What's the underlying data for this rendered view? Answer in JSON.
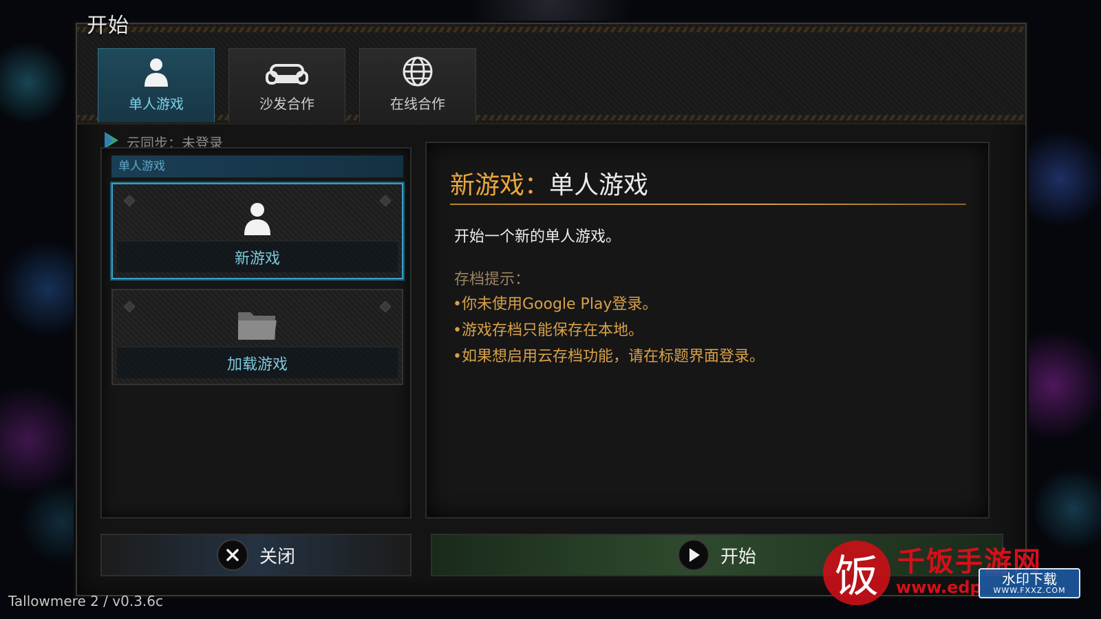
{
  "window": {
    "title": "开始"
  },
  "tabs": [
    {
      "label": "单人游戏",
      "icon": "person-icon",
      "active": true
    },
    {
      "label": "沙发合作",
      "icon": "sofa-icon",
      "active": false
    },
    {
      "label": "在线合作",
      "icon": "globe-icon",
      "active": false
    }
  ],
  "cloud_sync": {
    "label": "云同步：未登录",
    "icon": "google-play-icon"
  },
  "left_panel": {
    "header": "单人游戏",
    "cards": [
      {
        "label": "新游戏",
        "icon": "person-icon",
        "selected": true
      },
      {
        "label": "加载游戏",
        "icon": "folder-icon",
        "selected": false
      }
    ]
  },
  "detail": {
    "title_prefix": "新游戏：",
    "title_rest": "单人游戏",
    "description": "开始一个新的单人游戏。",
    "hint_header": "存档提示：",
    "hints": [
      "•你未使用Google Play登录。",
      "•游戏存档只能保存在本地。",
      "•如果想启用云存档功能，请在标题界面登录。"
    ]
  },
  "buttons": {
    "close": {
      "label": "关闭",
      "icon": "close-icon"
    },
    "start": {
      "label": "开始",
      "icon": "play-icon"
    }
  },
  "version": "Tallowmere 2 / v0.3.6c",
  "watermark": {
    "seal_char": "饭",
    "name": "千饭手游网",
    "url": "www.edp",
    "badge": "水印下载",
    "badge_sub": "WWW.FXXZ.COM"
  },
  "colors": {
    "accent_cyan": "#7ec8dc",
    "accent_gold": "#e9a73f",
    "hint_gold": "#d8a14a",
    "watermark_red": "#d4101a"
  }
}
